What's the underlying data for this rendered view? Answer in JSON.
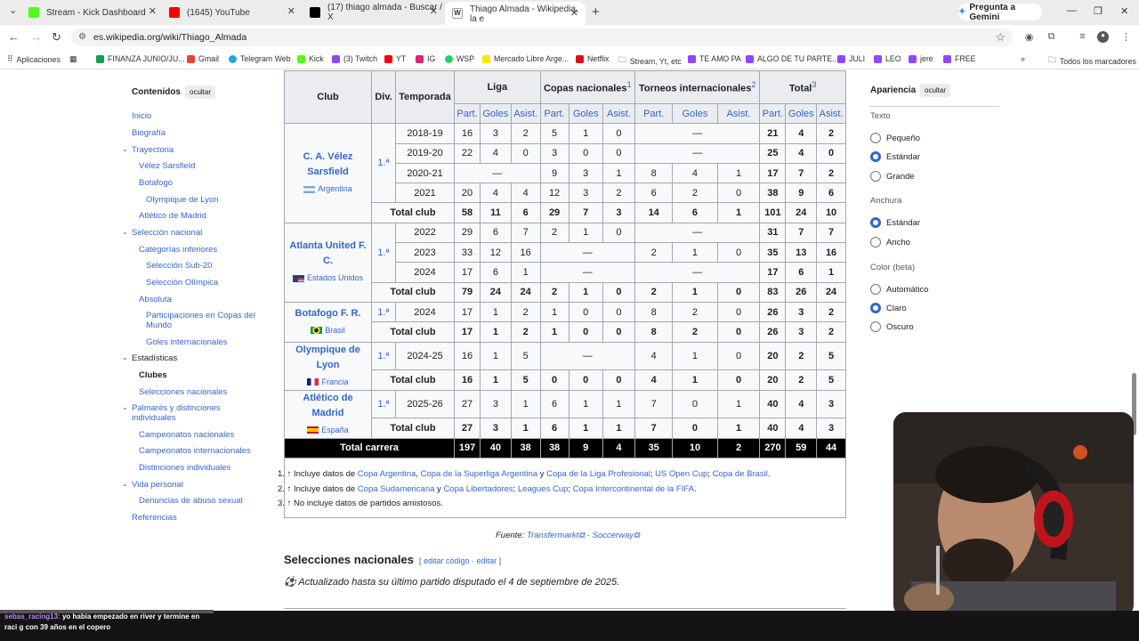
{
  "browser": {
    "tabs": [
      {
        "title": "Stream - Kick Dashboard",
        "color": "#53fc18"
      },
      {
        "title": "(1645) YouTube",
        "color": "#ff0000"
      },
      {
        "title": "(17) thiago almada - Buscar / X",
        "color": "#000000"
      },
      {
        "title": "Thiago Almada - Wikipedia, la e",
        "color": "#ffffff"
      }
    ],
    "gemini_label": "Pregunta a Gemini",
    "url": "es.wikipedia.org/wiki/Thiago_Almada",
    "bookmarks": [
      "Aplicaciones",
      "FINANZA JUNIO/JU...",
      "Gmail",
      "Telegram Web",
      "Kick",
      "(3) Twitch",
      "YT",
      "IG",
      "WSP",
      "Mercado Libre Arge...",
      "Netflix",
      "Stream, Yt, etc",
      "TE AMO PA",
      "ALGO DE TU PARTE...",
      "JULI",
      "LEO",
      "jere",
      "FREE"
    ],
    "all_bookmarks": "Todos los marcadores"
  },
  "toc": {
    "title": "Contenidos",
    "hide_label": "ocultar",
    "items": [
      {
        "label": "Inicio"
      },
      {
        "label": "Biografía"
      },
      {
        "label": "Trayectoria"
      },
      {
        "label": "Vélez Sarsfield"
      },
      {
        "label": "Botafogo"
      },
      {
        "label": "Olympique de Lyon"
      },
      {
        "label": "Atlético de Madrid"
      },
      {
        "label": "Selección nacional"
      },
      {
        "label": "Categorías inferiores"
      },
      {
        "label": "Selección Sub-20"
      },
      {
        "label": "Selección Olímpica"
      },
      {
        "label": "Absoluta"
      },
      {
        "label": "Participaciones en Copas del Mundo"
      },
      {
        "label": "Goles internacionales"
      },
      {
        "label": "Estadísticas"
      },
      {
        "label": "Clubes"
      },
      {
        "label": "Selecciones nacionales"
      },
      {
        "label": "Palmarés y distinciones individuales"
      },
      {
        "label": "Campeonatos nacionales"
      },
      {
        "label": "Campeonatos internacionales"
      },
      {
        "label": "Distinciones individuales"
      },
      {
        "label": "Vida personal"
      },
      {
        "label": "Denuncias de abuso sexual"
      },
      {
        "label": "Referencias"
      }
    ]
  },
  "table": {
    "headers": {
      "club": "Club",
      "div": "Div.",
      "season": "Temporada",
      "liga": "Liga",
      "copas": "Copas nacionales",
      "copas_sup": "1",
      "torneos": "Torneos internacionales",
      "torneos_sup": "2",
      "total": "Total",
      "total_sup": "3"
    },
    "sub": [
      "Part.",
      "Goles",
      "Asist.",
      "Part.",
      "Goles",
      "Asist.",
      "Part.",
      "Goles",
      "Asist.",
      "Part.",
      "Goles",
      "Asist."
    ],
    "clubs": [
      {
        "name": "C. A. Vélez Sarsfield",
        "country": "Argentina",
        "div": "1.ª",
        "rows": [
          [
            "2018-19",
            "16",
            "3",
            "2",
            "5",
            "1",
            "0",
            "—",
            "21",
            "4",
            "2"
          ],
          [
            "2019-20",
            "22",
            "4",
            "0",
            "3",
            "0",
            "0",
            "—",
            "25",
            "4",
            "0"
          ],
          [
            "2020-21",
            "—",
            "9",
            "3",
            "1",
            "8",
            "4",
            "1",
            "17",
            "7",
            "2"
          ],
          [
            "2021",
            "20",
            "4",
            "4",
            "12",
            "3",
            "2",
            "6",
            "2",
            "0",
            "38",
            "9",
            "6"
          ]
        ],
        "total": [
          "Total club",
          "58",
          "11",
          "6",
          "29",
          "7",
          "3",
          "14",
          "6",
          "1",
          "101",
          "24",
          "10"
        ]
      },
      {
        "name": "Atlanta United F. C.",
        "country": "Estados Unidos",
        "div": "1.ª",
        "rows": [
          [
            "2022",
            "29",
            "6",
            "7",
            "2",
            "1",
            "0",
            "—",
            "31",
            "7",
            "7"
          ],
          [
            "2023",
            "33",
            "12",
            "16",
            "—",
            "2",
            "1",
            "0",
            "35",
            "13",
            "16"
          ],
          [
            "2024",
            "17",
            "6",
            "1",
            "—",
            "—",
            "17",
            "6",
            "1"
          ]
        ],
        "total": [
          "Total club",
          "79",
          "24",
          "24",
          "2",
          "1",
          "0",
          "2",
          "1",
          "0",
          "83",
          "26",
          "24"
        ]
      },
      {
        "name": "Botafogo F. R.",
        "country": "Brasil",
        "div": "1.ª",
        "rows": [
          [
            "2024",
            "17",
            "1",
            "2",
            "1",
            "0",
            "0",
            "8",
            "2",
            "0",
            "26",
            "3",
            "2"
          ]
        ],
        "total": [
          "Total club",
          "17",
          "1",
          "2",
          "1",
          "0",
          "0",
          "8",
          "2",
          "0",
          "26",
          "3",
          "2"
        ]
      },
      {
        "name": "Olympique de Lyon",
        "country": "Francia",
        "div": "1.ª",
        "rows": [
          [
            "2024-25",
            "16",
            "1",
            "5",
            "—",
            "4",
            "1",
            "0",
            "20",
            "2",
            "5"
          ]
        ],
        "total": [
          "Total club",
          "16",
          "1",
          "5",
          "0",
          "0",
          "0",
          "4",
          "1",
          "0",
          "20",
          "2",
          "5"
        ]
      },
      {
        "name": "Atlético de Madrid",
        "country": "España",
        "div": "1.ª",
        "rows": [
          [
            "2025-26",
            "27",
            "3",
            "1",
            "6",
            "1",
            "1",
            "7",
            "0",
            "1",
            "40",
            "4",
            "3"
          ]
        ],
        "total": [
          "Total club",
          "27",
          "3",
          "1",
          "6",
          "1",
          "1",
          "7",
          "0",
          "1",
          "40",
          "4",
          "3"
        ]
      }
    ],
    "career": [
      "Total carrera",
      "197",
      "40",
      "38",
      "38",
      "9",
      "4",
      "35",
      "10",
      "2",
      "270",
      "59",
      "44"
    ]
  },
  "notes": [
    {
      "num": "1.",
      "arrow": "↑",
      "pre": "Incluye datos de",
      "links": [
        "Copa Argentina",
        "Copa de la Superliga Argentina",
        "Copa de la Liga Profesional",
        "US Open Cup",
        "Copa de Brasil"
      ],
      "seps": [
        ", ",
        " y ",
        "; ",
        "; ",
        "."
      ]
    },
    {
      "num": "2.",
      "arrow": "↑",
      "pre": "Incluye datos de",
      "links": [
        "Copa Sudamericana",
        "Copa Libertadores",
        "Leagues Cup",
        "Copa Intercontinental de la FIFA"
      ],
      "seps": [
        " y ",
        "; ",
        "; ",
        "."
      ]
    },
    {
      "num": "3.",
      "arrow": "↑",
      "text": "No incluye datos de partidos amistosos."
    }
  ],
  "source": {
    "label": "Fuente:",
    "links": [
      "Transfermarkt",
      "Soccerway"
    ],
    "sep": " · "
  },
  "section": {
    "title": "Selecciones nacionales",
    "edit_code": "editar código",
    "edit": "editar",
    "updated": "Actualizado hasta su último partido disputado el 4 de septiembre de 2025."
  },
  "appearance": {
    "title": "Apariencia",
    "hide_label": "ocultar",
    "text_label": "Texto",
    "text_opts": [
      "Pequeño",
      "Estándar",
      "Grande"
    ],
    "text_sel": 1,
    "width_label": "Anchura",
    "width_opts": [
      "Estándar",
      "Ancho"
    ],
    "width_sel": 0,
    "color_label": "Color (beta)",
    "color_opts": [
      "Automático",
      "Claro",
      "Oscuro"
    ],
    "color_sel": 1
  },
  "chat": {
    "user": "sebas_racing13:",
    "message": "yo habia empezado en river y termine en raci g con 39 años en el copero"
  }
}
